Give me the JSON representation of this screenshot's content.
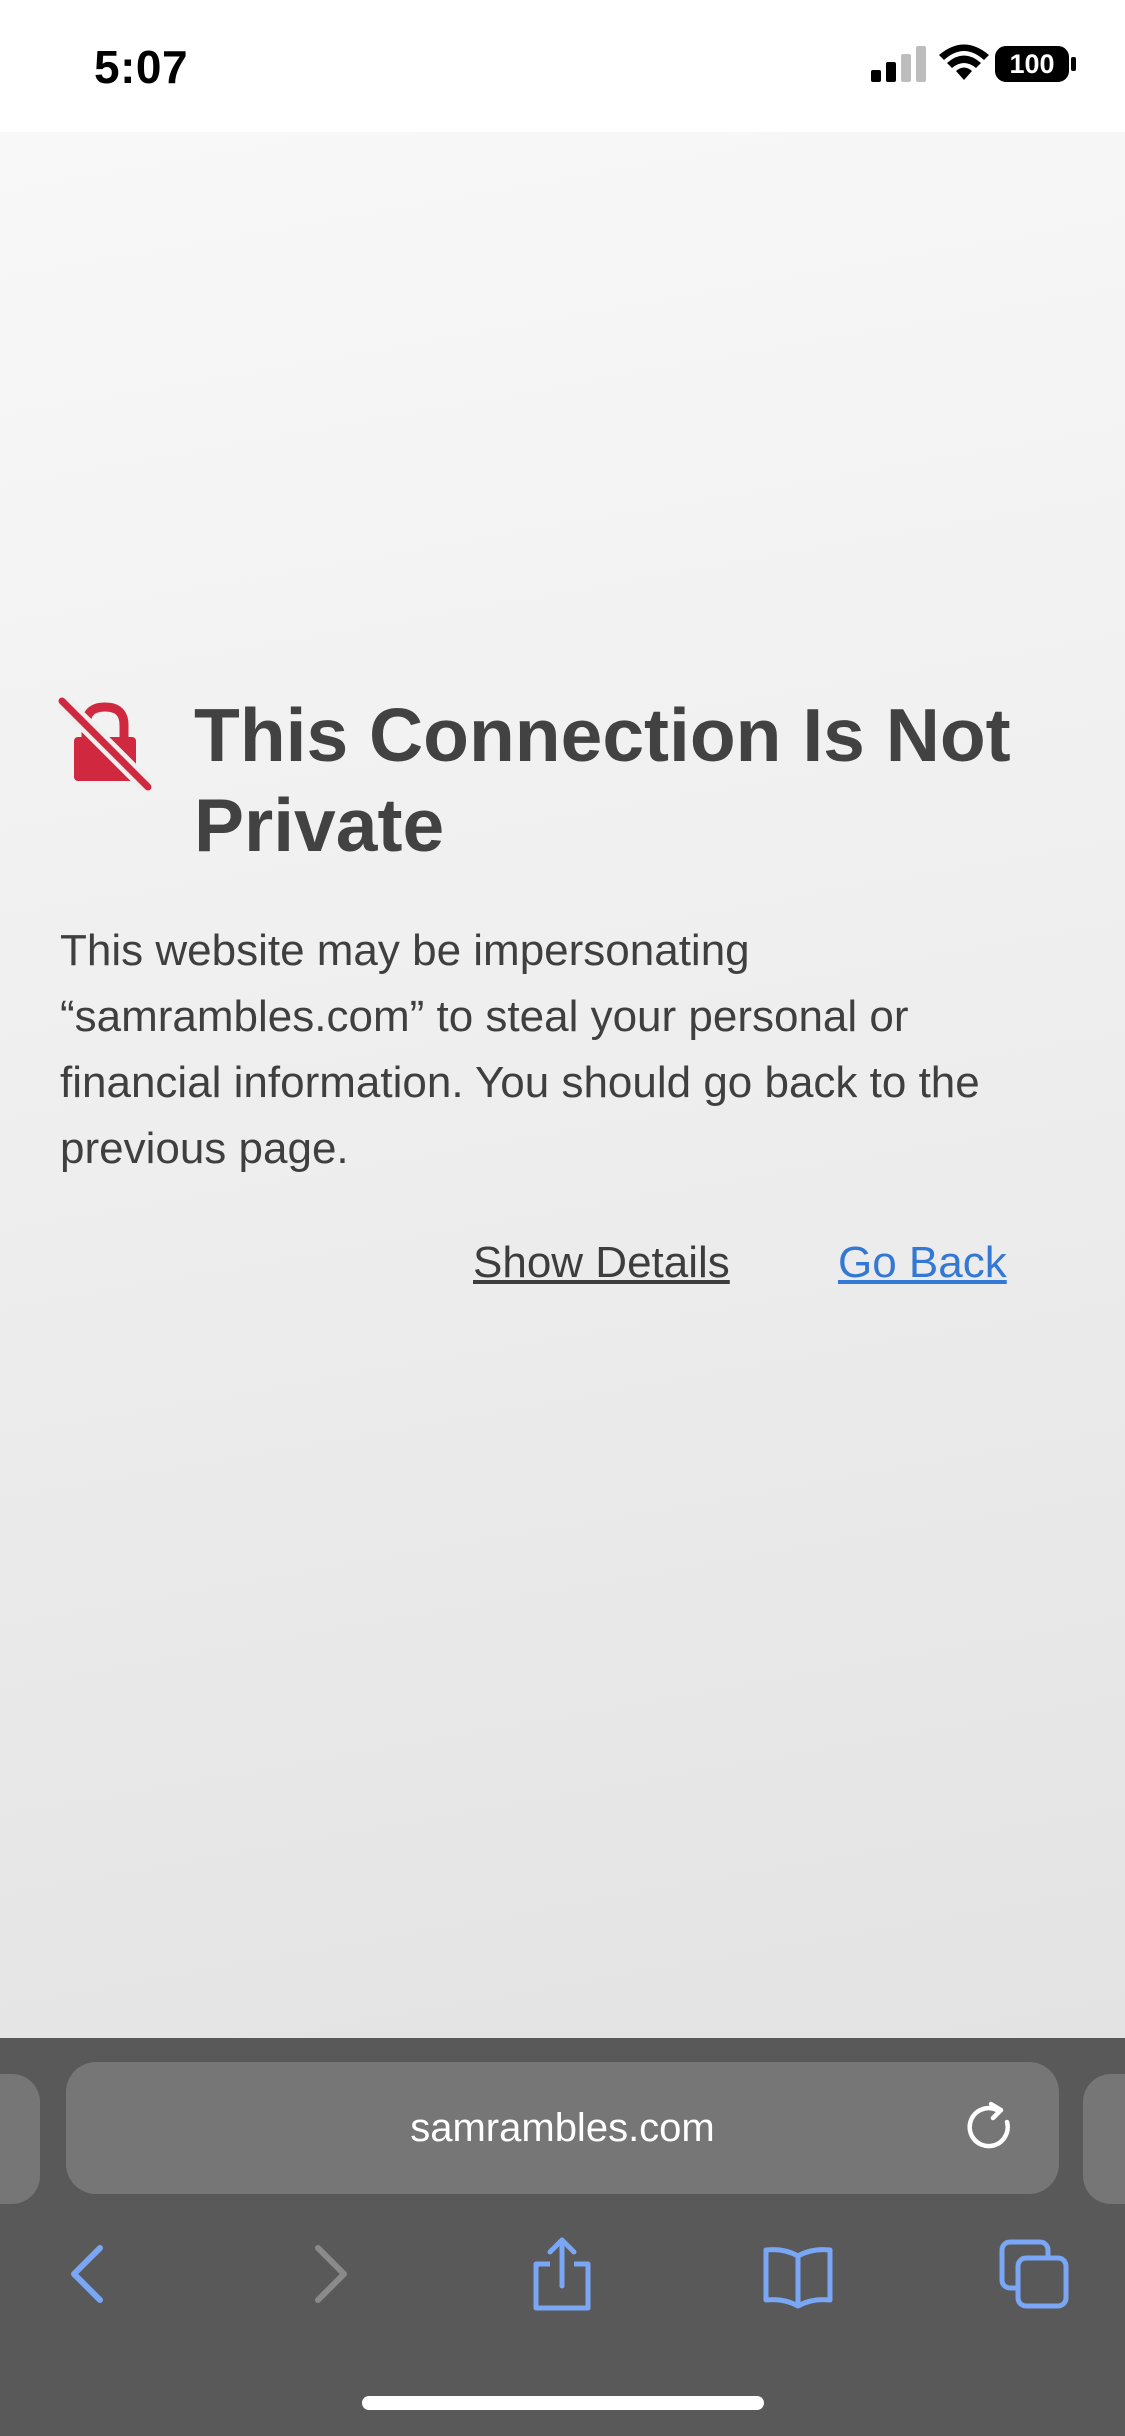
{
  "status_bar": {
    "time": "5:07",
    "battery_level": "100",
    "signal_bars_active": 2,
    "signal_bars_total": 4
  },
  "error_page": {
    "icon": "crossed-lock-icon",
    "title": "This Connection Is Not Private",
    "message": "This website may be impersonating “samrambles.com” to steal your personal or financial information. You should go back to the previous page.",
    "show_details_label": "Show Details",
    "go_back_label": "Go Back"
  },
  "browser": {
    "address": "samrambles.com",
    "toolbar_icons": [
      "back-icon",
      "forward-icon",
      "share-icon",
      "bookmarks-icon",
      "tabs-icon"
    ]
  },
  "colors": {
    "warning_red": "#d0293f",
    "link_blue": "#3478d6",
    "title_gray": "#424242",
    "toolbar_bg": "#595959",
    "toolbar_icon_blue": "#7aa7f5"
  }
}
